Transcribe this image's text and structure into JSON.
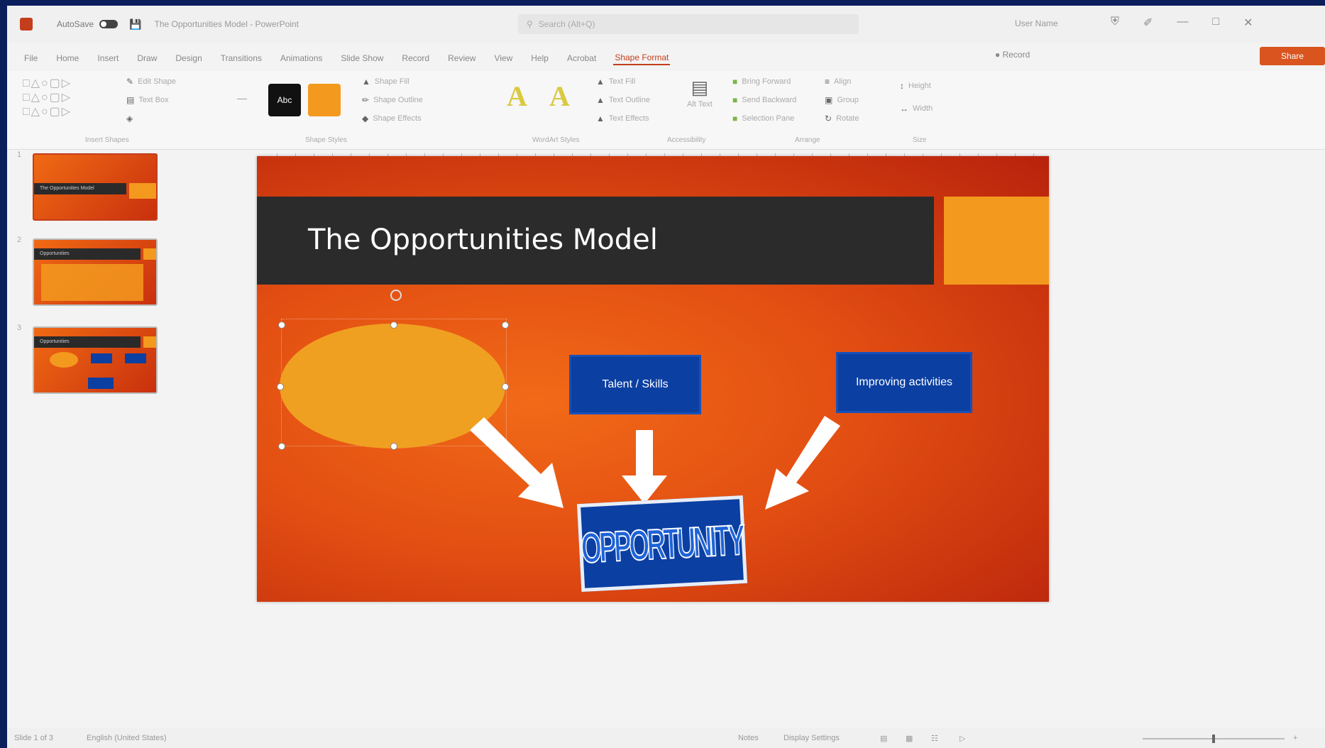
{
  "titlebar": {
    "autosave_label": "AutoSave",
    "doc_title": "The Opportunities Model - PowerPoint",
    "search_placeholder": "Search (Alt+Q)",
    "user_name": "User Name"
  },
  "menu": {
    "tabs": [
      "File",
      "Home",
      "Insert",
      "Draw",
      "Design",
      "Transitions",
      "Animations",
      "Slide Show",
      "Record",
      "Review",
      "View",
      "Help",
      "Acrobat",
      "Shape Format"
    ],
    "active_tab": "Shape Format",
    "record_label": "Record",
    "share_label": "Share"
  },
  "ribbon": {
    "insert_shapes_label": "Insert Shapes",
    "edit_shape": "Edit Shape",
    "text_box": "Text Box",
    "shape_styles_label": "Shape Styles",
    "style_abc": "Abc",
    "shape_fill": "Shape Fill",
    "shape_outline": "Shape Outline",
    "shape_effects": "Shape Effects",
    "wordart_label": "WordArt Styles",
    "wordart_glyph": "A",
    "text_fill": "Text Fill",
    "text_outline": "Text Outline",
    "text_effects": "Text Effects",
    "accessibility_label": "Accessibility",
    "alt_text": "Alt Text",
    "arrange_label": "Arrange",
    "bring_forward": "Bring Forward",
    "send_backward": "Send Backward",
    "selection_pane": "Selection Pane",
    "align": "Align",
    "group": "Group",
    "rotate": "Rotate",
    "size_label": "Size",
    "height": "Height",
    "width": "Width"
  },
  "thumbnails": [
    {
      "number": "1",
      "title": "The Opportunities Model"
    },
    {
      "number": "2",
      "title": "Opportunities"
    },
    {
      "number": "3",
      "title": "Opportunities"
    }
  ],
  "slide": {
    "title": "The Opportunities Model",
    "box_talent": "Talent / Skills",
    "box_activities": "Improving activities",
    "opportunity": "OPPORTUNITY"
  },
  "statusbar": {
    "slide_counter": "Slide 1 of 3",
    "language": "English (United States)",
    "notes": "Notes",
    "display_settings": "Display Settings",
    "zoom": "+"
  },
  "colors": {
    "slide_orange": "#e24e12",
    "accent_orange": "#f39a1e",
    "title_bar": "#2b2b2b",
    "box_blue": "#0b3fa2",
    "ppt_accent": "#c43e1c"
  }
}
